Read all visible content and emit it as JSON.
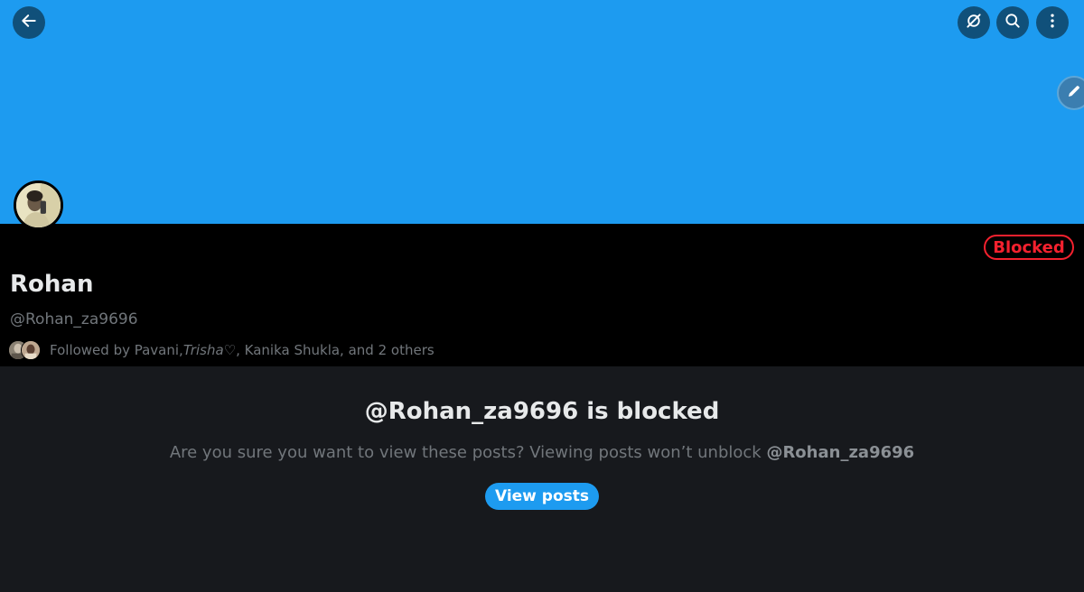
{
  "header": {
    "icons": {
      "back": "arrow-left-icon",
      "grok": "grok-icon",
      "search": "search-icon",
      "more": "more-vertical-icon",
      "edit": "pencil-icon"
    },
    "banner_color": "#1d9bf0"
  },
  "profile": {
    "blocked_label": "Blocked",
    "name": "Rohan",
    "handle": "@Rohan_za9696",
    "followed_by": {
      "prefix": "Followed by Pavani, ",
      "italic_name": "Trisha",
      "suffix": " ♡, Kanika Shukla, and 2 others"
    }
  },
  "notice": {
    "title": "@Rohan_za9696 is blocked",
    "text": "Are you sure you want to view these posts? Viewing posts won’t unblock ",
    "text_handle": "@Rohan_za9696",
    "button_label": "View posts"
  },
  "colors": {
    "accent": "#1d9bf0",
    "danger": "#f4212e",
    "background": "#17191d",
    "header_bg": "#000000",
    "muted_text": "#71767b",
    "primary_text": "#e7e9ea"
  }
}
